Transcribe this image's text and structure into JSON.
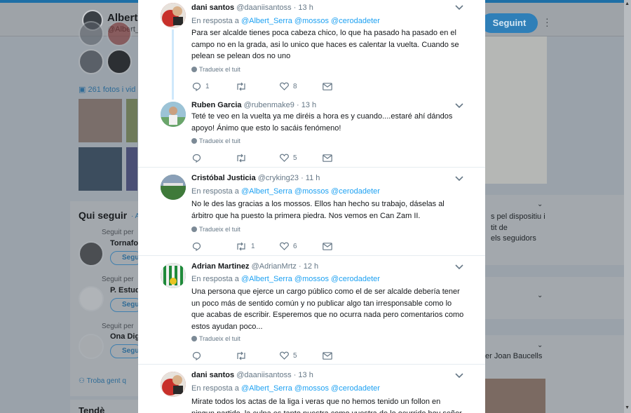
{
  "background": {
    "profile_name": "Albert",
    "profile_handle": "@Albert_",
    "follow_label": "Seguint",
    "photos_label": "261 fotos i vid",
    "who_to_follow_title": "Qui seguir",
    "who_to_follow_sub": "· Ac",
    "suggestions": [
      {
        "followed_by": "Seguit per",
        "name": "Tornafo",
        "button": "Segu"
      },
      {
        "followed_by": "Seguit per",
        "name": "P. Estud",
        "button": "Segu"
      },
      {
        "followed_by": "Seguit per",
        "name": "Ona Dig",
        "button": "Segu"
      }
    ],
    "find_people": "Troba gent q",
    "trends_label": "Tendè",
    "right_texts": [
      "s pel dispositiu i",
      "tit de",
      "els seguidors"
    ],
    "right_person": "er Joan Baucells"
  },
  "tweets": [
    {
      "name": "dani santos",
      "handle": "@daaniisantoss",
      "time": "· 13 h",
      "reply_prefix": "En resposta a",
      "reply_to": "@Albert_Serra @mossos @cerodadeter",
      "text": "Para ser alcalde tienes poca cabeza chico, lo que ha pasado ha pasado en el campo no en la grada, asi lo unico que haces es calentar la vuelta. Cuando se pelean se pelean dos no uno",
      "translate": "Tradueix el tuit",
      "replies": "1",
      "retweets": "",
      "likes": "8"
    },
    {
      "name": "Ruben Garcia",
      "handle": "@rubenmake9",
      "time": "· 13 h",
      "reply_prefix": "",
      "reply_to": "",
      "text": "Teté te veo en la vuelta ya me diréis a hora es y cuando....estaré ahí dándos apoyo! Ánimo que esto lo sacáis fenómeno!",
      "translate": "Tradueix el tuit",
      "replies": "",
      "retweets": "",
      "likes": "5"
    },
    {
      "name": "Cristóbal Justicia",
      "handle": "@cryking23",
      "time": "· 11 h",
      "reply_prefix": "En resposta a",
      "reply_to": "@Albert_Serra @mossos @cerodadeter",
      "text": "No le des las gracias a los mossos. Ellos han hecho su trabajo, dáselas al árbitro que ha puesto la primera piedra. Nos vemos en Can Zam II.",
      "translate": "Tradueix el tuit",
      "replies": "",
      "retweets": "1",
      "likes": "6"
    },
    {
      "name": "Adrian Martinez",
      "handle": "@AdrianMrtz",
      "time": "· 12 h",
      "reply_prefix": "En resposta a",
      "reply_to": "@Albert_Serra @mossos @cerodadeter",
      "text": "Una persona que ejerce un cargo público como el de ser alcalde debería tener un poco más de sentido común y no publicar algo tan irresponsable como lo que acabas de escribir. Esperemos que no ocurra nada pero comentarios como estos ayudan poco...",
      "translate": "Tradueix el tuit",
      "replies": "",
      "retweets": "",
      "likes": "5"
    },
    {
      "name": "dani santos",
      "handle": "@daaniisantoss",
      "time": "· 13 h",
      "reply_prefix": "En resposta a",
      "reply_to": "@Albert_Serra @mossos @cerodadeter",
      "text": "Mirate todos los actas de la liga i veras que no hemos tenido un follon en ningun partido, la culpa es tanto nuestra como vuestra de lo ocurrido hoy señor alcalde",
      "translate": "",
      "replies": "",
      "retweets": "",
      "likes": ""
    }
  ],
  "colors": {
    "link": "#1da1f2",
    "secondary_text": "#657786",
    "icon": "#657786"
  },
  "icons": [
    "reply-icon",
    "retweet-icon",
    "like-icon",
    "dm-icon",
    "chevron-down-icon",
    "globe-icon"
  ]
}
